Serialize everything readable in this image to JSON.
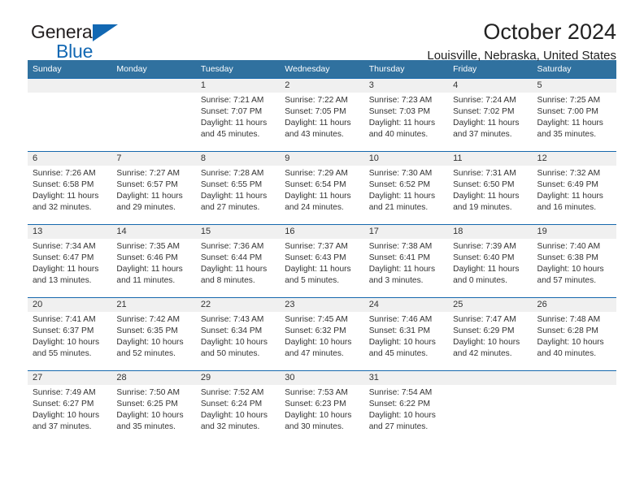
{
  "brand": {
    "name_top": "General",
    "name_bottom": "Blue",
    "triangle_color": "#1268b3"
  },
  "header": {
    "title": "October 2024",
    "subtitle": "Louisville, Nebraska, United States"
  },
  "theme": {
    "header_bar": "#30719f",
    "row_rule": "#1668ad",
    "daynum_band": "#f0f0f0"
  },
  "weekdays": [
    "Sunday",
    "Monday",
    "Tuesday",
    "Wednesday",
    "Thursday",
    "Friday",
    "Saturday"
  ],
  "weeks": [
    [
      {
        "day": "",
        "lines": []
      },
      {
        "day": "",
        "lines": []
      },
      {
        "day": "1",
        "lines": [
          "Sunrise: 7:21 AM",
          "Sunset: 7:07 PM",
          "Daylight: 11 hours",
          "and 45 minutes."
        ]
      },
      {
        "day": "2",
        "lines": [
          "Sunrise: 7:22 AM",
          "Sunset: 7:05 PM",
          "Daylight: 11 hours",
          "and 43 minutes."
        ]
      },
      {
        "day": "3",
        "lines": [
          "Sunrise: 7:23 AM",
          "Sunset: 7:03 PM",
          "Daylight: 11 hours",
          "and 40 minutes."
        ]
      },
      {
        "day": "4",
        "lines": [
          "Sunrise: 7:24 AM",
          "Sunset: 7:02 PM",
          "Daylight: 11 hours",
          "and 37 minutes."
        ]
      },
      {
        "day": "5",
        "lines": [
          "Sunrise: 7:25 AM",
          "Sunset: 7:00 PM",
          "Daylight: 11 hours",
          "and 35 minutes."
        ]
      }
    ],
    [
      {
        "day": "6",
        "lines": [
          "Sunrise: 7:26 AM",
          "Sunset: 6:58 PM",
          "Daylight: 11 hours",
          "and 32 minutes."
        ]
      },
      {
        "day": "7",
        "lines": [
          "Sunrise: 7:27 AM",
          "Sunset: 6:57 PM",
          "Daylight: 11 hours",
          "and 29 minutes."
        ]
      },
      {
        "day": "8",
        "lines": [
          "Sunrise: 7:28 AM",
          "Sunset: 6:55 PM",
          "Daylight: 11 hours",
          "and 27 minutes."
        ]
      },
      {
        "day": "9",
        "lines": [
          "Sunrise: 7:29 AM",
          "Sunset: 6:54 PM",
          "Daylight: 11 hours",
          "and 24 minutes."
        ]
      },
      {
        "day": "10",
        "lines": [
          "Sunrise: 7:30 AM",
          "Sunset: 6:52 PM",
          "Daylight: 11 hours",
          "and 21 minutes."
        ]
      },
      {
        "day": "11",
        "lines": [
          "Sunrise: 7:31 AM",
          "Sunset: 6:50 PM",
          "Daylight: 11 hours",
          "and 19 minutes."
        ]
      },
      {
        "day": "12",
        "lines": [
          "Sunrise: 7:32 AM",
          "Sunset: 6:49 PM",
          "Daylight: 11 hours",
          "and 16 minutes."
        ]
      }
    ],
    [
      {
        "day": "13",
        "lines": [
          "Sunrise: 7:34 AM",
          "Sunset: 6:47 PM",
          "Daylight: 11 hours",
          "and 13 minutes."
        ]
      },
      {
        "day": "14",
        "lines": [
          "Sunrise: 7:35 AM",
          "Sunset: 6:46 PM",
          "Daylight: 11 hours",
          "and 11 minutes."
        ]
      },
      {
        "day": "15",
        "lines": [
          "Sunrise: 7:36 AM",
          "Sunset: 6:44 PM",
          "Daylight: 11 hours",
          "and 8 minutes."
        ]
      },
      {
        "day": "16",
        "lines": [
          "Sunrise: 7:37 AM",
          "Sunset: 6:43 PM",
          "Daylight: 11 hours",
          "and 5 minutes."
        ]
      },
      {
        "day": "17",
        "lines": [
          "Sunrise: 7:38 AM",
          "Sunset: 6:41 PM",
          "Daylight: 11 hours",
          "and 3 minutes."
        ]
      },
      {
        "day": "18",
        "lines": [
          "Sunrise: 7:39 AM",
          "Sunset: 6:40 PM",
          "Daylight: 11 hours",
          "and 0 minutes."
        ]
      },
      {
        "day": "19",
        "lines": [
          "Sunrise: 7:40 AM",
          "Sunset: 6:38 PM",
          "Daylight: 10 hours",
          "and 57 minutes."
        ]
      }
    ],
    [
      {
        "day": "20",
        "lines": [
          "Sunrise: 7:41 AM",
          "Sunset: 6:37 PM",
          "Daylight: 10 hours",
          "and 55 minutes."
        ]
      },
      {
        "day": "21",
        "lines": [
          "Sunrise: 7:42 AM",
          "Sunset: 6:35 PM",
          "Daylight: 10 hours",
          "and 52 minutes."
        ]
      },
      {
        "day": "22",
        "lines": [
          "Sunrise: 7:43 AM",
          "Sunset: 6:34 PM",
          "Daylight: 10 hours",
          "and 50 minutes."
        ]
      },
      {
        "day": "23",
        "lines": [
          "Sunrise: 7:45 AM",
          "Sunset: 6:32 PM",
          "Daylight: 10 hours",
          "and 47 minutes."
        ]
      },
      {
        "day": "24",
        "lines": [
          "Sunrise: 7:46 AM",
          "Sunset: 6:31 PM",
          "Daylight: 10 hours",
          "and 45 minutes."
        ]
      },
      {
        "day": "25",
        "lines": [
          "Sunrise: 7:47 AM",
          "Sunset: 6:29 PM",
          "Daylight: 10 hours",
          "and 42 minutes."
        ]
      },
      {
        "day": "26",
        "lines": [
          "Sunrise: 7:48 AM",
          "Sunset: 6:28 PM",
          "Daylight: 10 hours",
          "and 40 minutes."
        ]
      }
    ],
    [
      {
        "day": "27",
        "lines": [
          "Sunrise: 7:49 AM",
          "Sunset: 6:27 PM",
          "Daylight: 10 hours",
          "and 37 minutes."
        ]
      },
      {
        "day": "28",
        "lines": [
          "Sunrise: 7:50 AM",
          "Sunset: 6:25 PM",
          "Daylight: 10 hours",
          "and 35 minutes."
        ]
      },
      {
        "day": "29",
        "lines": [
          "Sunrise: 7:52 AM",
          "Sunset: 6:24 PM",
          "Daylight: 10 hours",
          "and 32 minutes."
        ]
      },
      {
        "day": "30",
        "lines": [
          "Sunrise: 7:53 AM",
          "Sunset: 6:23 PM",
          "Daylight: 10 hours",
          "and 30 minutes."
        ]
      },
      {
        "day": "31",
        "lines": [
          "Sunrise: 7:54 AM",
          "Sunset: 6:22 PM",
          "Daylight: 10 hours",
          "and 27 minutes."
        ]
      },
      {
        "day": "",
        "lines": []
      },
      {
        "day": "",
        "lines": []
      }
    ]
  ]
}
